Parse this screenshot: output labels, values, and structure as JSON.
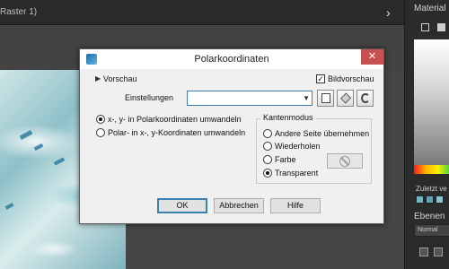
{
  "app": {
    "document_tab_title": "Raster 1)",
    "tab_scroll_icon": "chevron-right-icon",
    "right_panel": {
      "materials_title": "Material",
      "recent_label": "Zuletzt ve",
      "layers_title": "Ebenen",
      "blend_mode": "Normal"
    }
  },
  "dialog": {
    "title": "Polarkoordinaten",
    "close_glyph": "✕",
    "preview_label": "Vorschau",
    "image_preview_label": "Bildvorschau",
    "image_preview_checked": true,
    "settings_label": "Einstellungen",
    "settings_value": "",
    "conversion_options": [
      {
        "label": "x-, y- in Polarkoordinaten umwandeln",
        "selected": true
      },
      {
        "label": "Polar- in x-, y-Koordinaten umwandeln",
        "selected": false
      }
    ],
    "edge_mode": {
      "title": "Kantenmodus",
      "options": [
        {
          "label": "Andere Seite übernehmen",
          "selected": false
        },
        {
          "label": "Wiederholen",
          "selected": false
        },
        {
          "label": "Farbe",
          "selected": false
        },
        {
          "label": "Transparent",
          "selected": true
        }
      ]
    },
    "buttons": {
      "ok": "OK",
      "cancel": "Abbrechen",
      "help": "Hilfe"
    }
  }
}
